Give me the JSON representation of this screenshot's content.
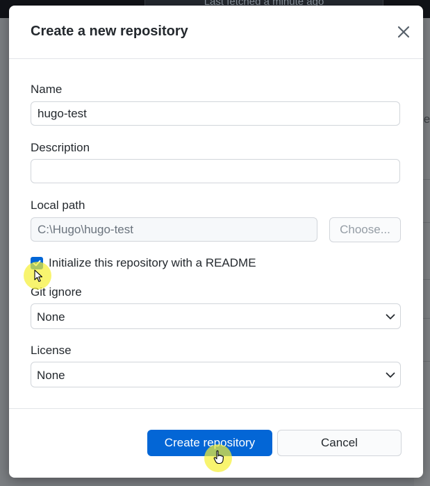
{
  "background": {
    "top_status": "Last fetched a minute ago",
    "right_partial_text": "ie"
  },
  "dialog": {
    "title": "Create a new repository",
    "close_icon": "close-icon",
    "name": {
      "label": "Name",
      "value": "hugo-test"
    },
    "description": {
      "label": "Description",
      "value": ""
    },
    "local_path": {
      "label": "Local path",
      "value": "C:\\Hugo\\hugo-test",
      "choose_label": "Choose..."
    },
    "readme": {
      "label": "Initialize this repository with a README",
      "checked": true
    },
    "git_ignore": {
      "label": "Git ignore",
      "selected": "None"
    },
    "license": {
      "label": "License",
      "selected": "None"
    },
    "buttons": {
      "create_label": "Create repository",
      "cancel_label": "Cancel"
    }
  },
  "colors": {
    "primary": "#0366d6",
    "cursor_highlight": "#f5f032"
  }
}
